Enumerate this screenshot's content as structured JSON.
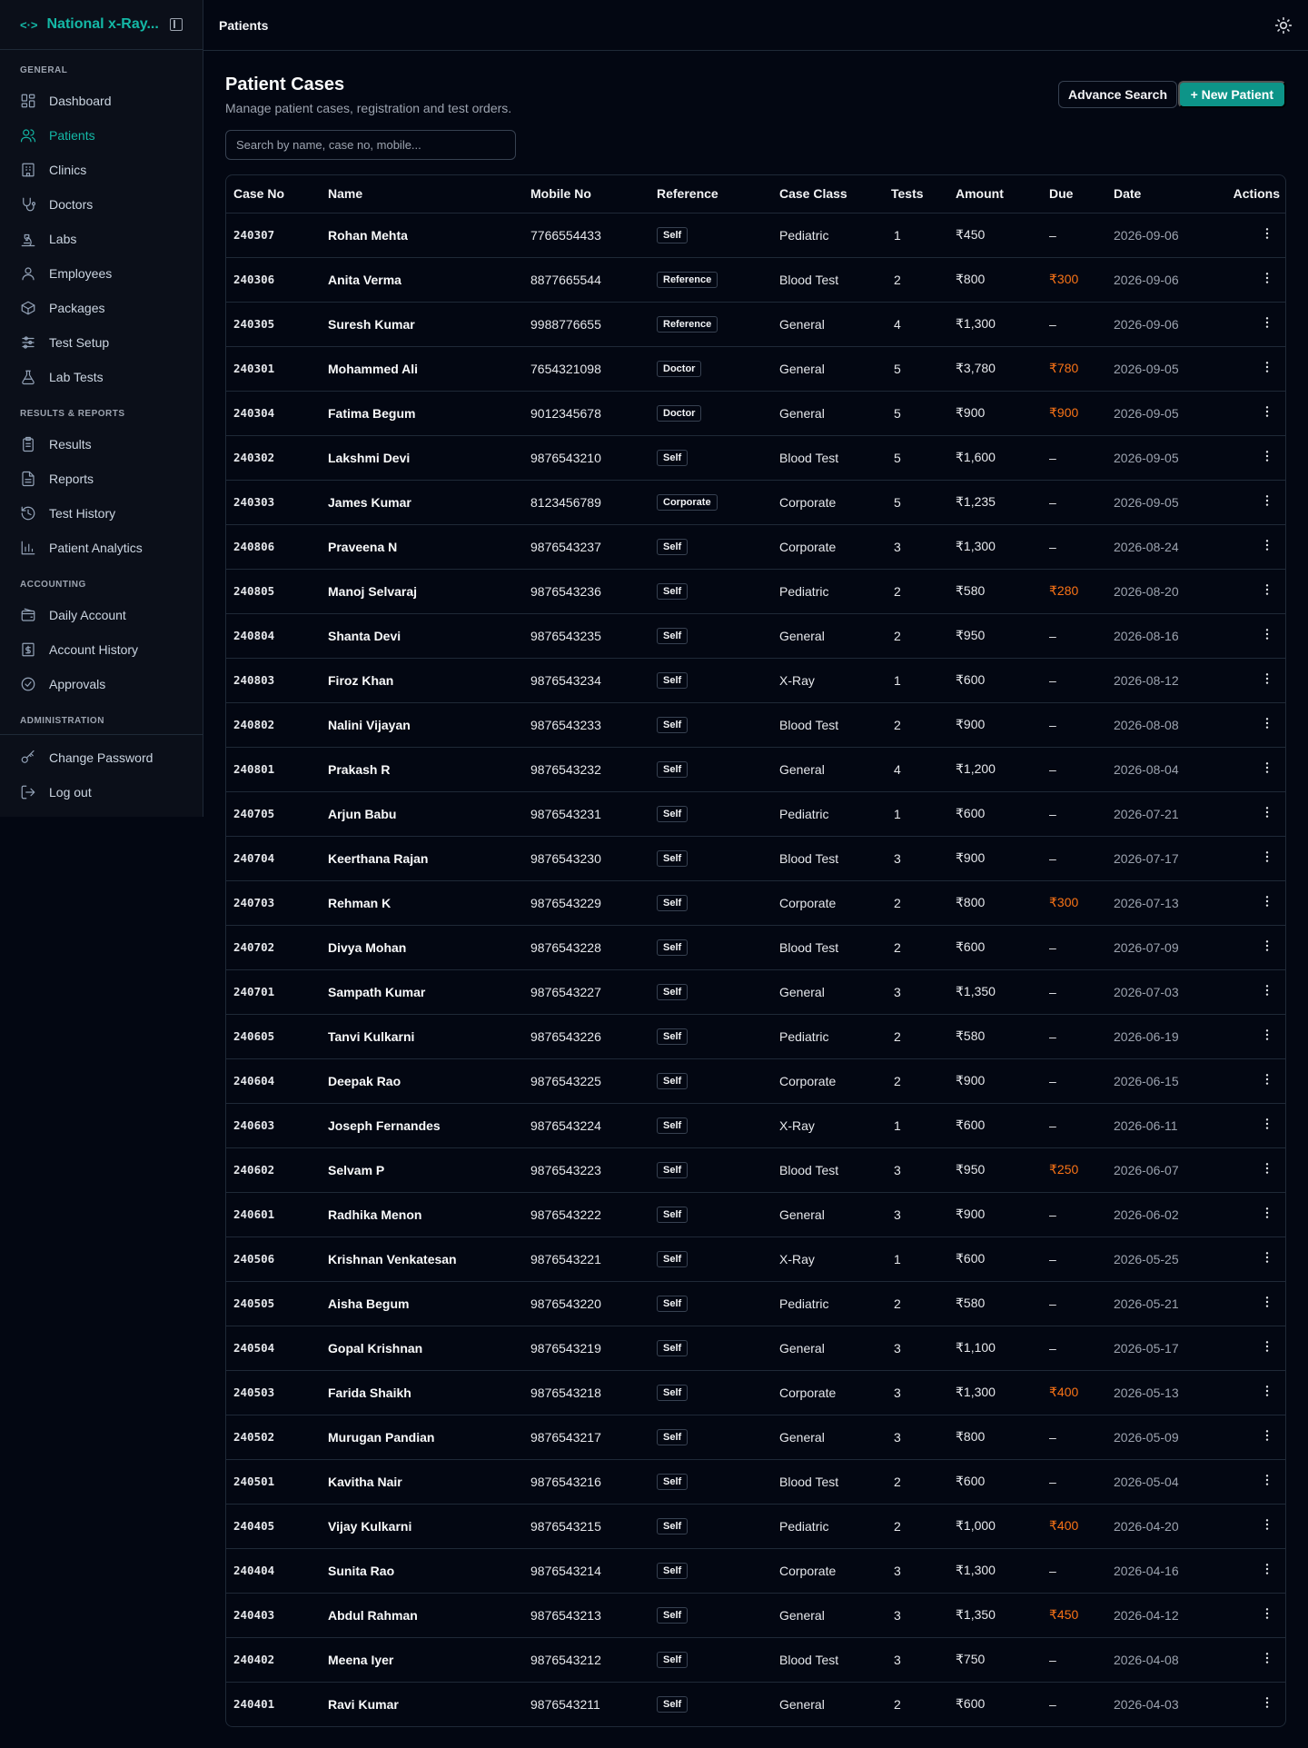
{
  "app": {
    "title": "National x-Ray...",
    "breadcrumb": "Patients"
  },
  "sidebar": {
    "sections": [
      {
        "label": "GENERAL",
        "items": [
          {
            "label": "Dashboard",
            "icon": "dashboard-icon"
          },
          {
            "label": "Patients",
            "icon": "users-icon",
            "active": true
          },
          {
            "label": "Clinics",
            "icon": "building-icon"
          },
          {
            "label": "Doctors",
            "icon": "stethoscope-icon"
          },
          {
            "label": "Labs",
            "icon": "microscope-icon"
          },
          {
            "label": "Employees",
            "icon": "user-icon"
          },
          {
            "label": "Packages",
            "icon": "package-icon"
          },
          {
            "label": "Test Setup",
            "icon": "sliders-icon"
          },
          {
            "label": "Lab Tests",
            "icon": "flask-icon"
          }
        ]
      },
      {
        "label": "RESULTS & REPORTS",
        "items": [
          {
            "label": "Results",
            "icon": "clipboard-icon"
          },
          {
            "label": "Reports",
            "icon": "file-icon"
          },
          {
            "label": "Test History",
            "icon": "history-icon"
          },
          {
            "label": "Patient Analytics",
            "icon": "chart-icon"
          }
        ]
      },
      {
        "label": "ACCOUNTING",
        "items": [
          {
            "label": "Daily Account",
            "icon": "wallet-icon"
          },
          {
            "label": "Account History",
            "icon": "receipt-icon"
          },
          {
            "label": "Approvals",
            "icon": "check-circle-icon"
          }
        ]
      },
      {
        "label": "ADMINISTRATION",
        "items": []
      }
    ],
    "footer_items": [
      {
        "label": "Change Password",
        "icon": "key-icon"
      },
      {
        "label": "Log out",
        "icon": "logout-icon"
      }
    ]
  },
  "page": {
    "title": "Patient Cases",
    "subtitle": "Manage patient cases, registration and test orders.",
    "advance_search_label": "Advance Search",
    "new_patient_label": "+ New Patient",
    "search_placeholder": "Search by name, case no, mobile..."
  },
  "table": {
    "columns": [
      "Case No",
      "Name",
      "Mobile No",
      "Reference",
      "Case Class",
      "Tests",
      "Amount",
      "Due",
      "Date",
      "Actions"
    ],
    "rows": [
      [
        "240307",
        "Rohan Mehta",
        "7766554433",
        "Self",
        "Pediatric",
        "1",
        "₹450",
        "–",
        "2026-09-06"
      ],
      [
        "240306",
        "Anita Verma",
        "8877665544",
        "Reference",
        "Blood Test",
        "2",
        "₹800",
        "₹300",
        "2026-09-06"
      ],
      [
        "240305",
        "Suresh Kumar",
        "9988776655",
        "Reference",
        "General",
        "4",
        "₹1,300",
        "–",
        "2026-09-06"
      ],
      [
        "240301",
        "Mohammed Ali",
        "7654321098",
        "Doctor",
        "General",
        "5",
        "₹3,780",
        "₹780",
        "2026-09-05"
      ],
      [
        "240304",
        "Fatima Begum",
        "9012345678",
        "Doctor",
        "General",
        "5",
        "₹900",
        "₹900",
        "2026-09-05"
      ],
      [
        "240302",
        "Lakshmi Devi",
        "9876543210",
        "Self",
        "Blood Test",
        "5",
        "₹1,600",
        "–",
        "2026-09-05"
      ],
      [
        "240303",
        "James Kumar",
        "8123456789",
        "Corporate",
        "Corporate",
        "5",
        "₹1,235",
        "–",
        "2026-09-05"
      ],
      [
        "240806",
        "Praveena N",
        "9876543237",
        "Self",
        "Corporate",
        "3",
        "₹1,300",
        "–",
        "2026-08-24"
      ],
      [
        "240805",
        "Manoj Selvaraj",
        "9876543236",
        "Self",
        "Pediatric",
        "2",
        "₹580",
        "₹280",
        "2026-08-20"
      ],
      [
        "240804",
        "Shanta Devi",
        "9876543235",
        "Self",
        "General",
        "2",
        "₹950",
        "–",
        "2026-08-16"
      ],
      [
        "240803",
        "Firoz Khan",
        "9876543234",
        "Self",
        "X-Ray",
        "1",
        "₹600",
        "–",
        "2026-08-12"
      ],
      [
        "240802",
        "Nalini Vijayan",
        "9876543233",
        "Self",
        "Blood Test",
        "2",
        "₹900",
        "–",
        "2026-08-08"
      ],
      [
        "240801",
        "Prakash R",
        "9876543232",
        "Self",
        "General",
        "4",
        "₹1,200",
        "–",
        "2026-08-04"
      ],
      [
        "240705",
        "Arjun Babu",
        "9876543231",
        "Self",
        "Pediatric",
        "1",
        "₹600",
        "–",
        "2026-07-21"
      ],
      [
        "240704",
        "Keerthana Rajan",
        "9876543230",
        "Self",
        "Blood Test",
        "3",
        "₹900",
        "–",
        "2026-07-17"
      ],
      [
        "240703",
        "Rehman K",
        "9876543229",
        "Self",
        "Corporate",
        "2",
        "₹800",
        "₹300",
        "2026-07-13"
      ],
      [
        "240702",
        "Divya Mohan",
        "9876543228",
        "Self",
        "Blood Test",
        "2",
        "₹600",
        "–",
        "2026-07-09"
      ],
      [
        "240701",
        "Sampath Kumar",
        "9876543227",
        "Self",
        "General",
        "3",
        "₹1,350",
        "–",
        "2026-07-03"
      ],
      [
        "240605",
        "Tanvi Kulkarni",
        "9876543226",
        "Self",
        "Pediatric",
        "2",
        "₹580",
        "–",
        "2026-06-19"
      ],
      [
        "240604",
        "Deepak Rao",
        "9876543225",
        "Self",
        "Corporate",
        "2",
        "₹900",
        "–",
        "2026-06-15"
      ],
      [
        "240603",
        "Joseph Fernandes",
        "9876543224",
        "Self",
        "X-Ray",
        "1",
        "₹600",
        "–",
        "2026-06-11"
      ],
      [
        "240602",
        "Selvam P",
        "9876543223",
        "Self",
        "Blood Test",
        "3",
        "₹950",
        "₹250",
        "2026-06-07"
      ],
      [
        "240601",
        "Radhika Menon",
        "9876543222",
        "Self",
        "General",
        "3",
        "₹900",
        "–",
        "2026-06-02"
      ],
      [
        "240506",
        "Krishnan Venkatesan",
        "9876543221",
        "Self",
        "X-Ray",
        "1",
        "₹600",
        "–",
        "2026-05-25"
      ],
      [
        "240505",
        "Aisha Begum",
        "9876543220",
        "Self",
        "Pediatric",
        "2",
        "₹580",
        "–",
        "2026-05-21"
      ],
      [
        "240504",
        "Gopal Krishnan",
        "9876543219",
        "Self",
        "General",
        "3",
        "₹1,100",
        "–",
        "2026-05-17"
      ],
      [
        "240503",
        "Farida Shaikh",
        "9876543218",
        "Self",
        "Corporate",
        "3",
        "₹1,300",
        "₹400",
        "2026-05-13"
      ],
      [
        "240502",
        "Murugan Pandian",
        "9876543217",
        "Self",
        "General",
        "3",
        "₹800",
        "–",
        "2026-05-09"
      ],
      [
        "240501",
        "Kavitha Nair",
        "9876543216",
        "Self",
        "Blood Test",
        "2",
        "₹600",
        "–",
        "2026-05-04"
      ],
      [
        "240405",
        "Vijay Kulkarni",
        "9876543215",
        "Self",
        "Pediatric",
        "2",
        "₹1,000",
        "₹400",
        "2026-04-20"
      ],
      [
        "240404",
        "Sunita Rao",
        "9876543214",
        "Self",
        "Corporate",
        "3",
        "₹1,300",
        "–",
        "2026-04-16"
      ],
      [
        "240403",
        "Abdul Rahman",
        "9876543213",
        "Self",
        "General",
        "3",
        "₹1,350",
        "₹450",
        "2026-04-12"
      ],
      [
        "240402",
        "Meena Iyer",
        "9876543212",
        "Self",
        "Blood Test",
        "3",
        "₹750",
        "–",
        "2026-04-08"
      ],
      [
        "240401",
        "Ravi Kumar",
        "9876543211",
        "Self",
        "General",
        "2",
        "₹600",
        "–",
        "2026-04-03"
      ]
    ]
  },
  "colors": {
    "accent": "#14b8a6",
    "primary_button": "#0d9488",
    "due": "#f97316",
    "background": "#030712"
  }
}
